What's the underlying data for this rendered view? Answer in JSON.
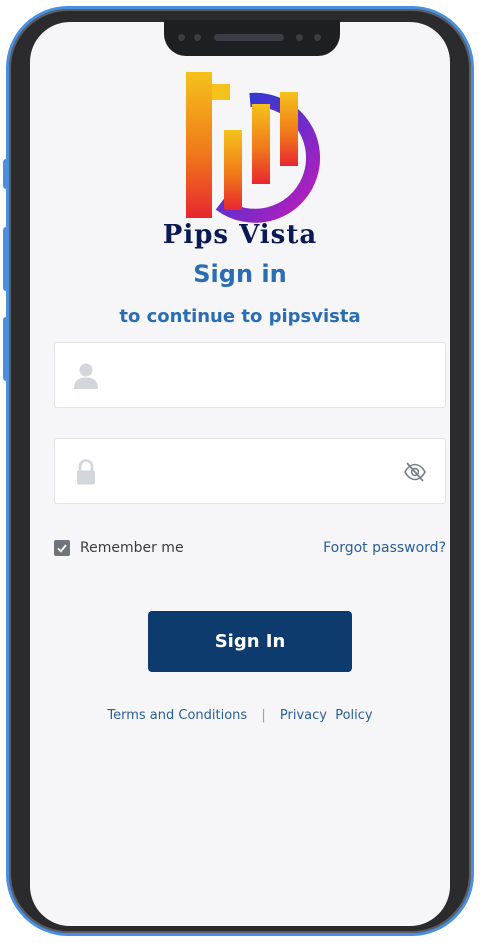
{
  "app": {
    "brand_name": "Pips Vista",
    "title": "Sign in",
    "subtitle": "to continue to pipsvista"
  },
  "form": {
    "username_value": "",
    "password_value": "",
    "remember_label": "Remember me",
    "remember_checked": true,
    "forgot_label": "Forgot password?",
    "submit_label": "Sign In"
  },
  "footer": {
    "terms_label": "Terms and Conditions",
    "separator": "|",
    "privacy_label": "Privacy  Policy"
  },
  "icons": {
    "username": "user-icon",
    "password": "lock-icon",
    "toggle_visibility": "eye-slash-icon",
    "checkbox": "check-icon"
  },
  "colors": {
    "primary_text": "#2a6db3",
    "button": "#0d3b6e",
    "brand_text": "#0b1a55",
    "frame_accent": "#4a8fe0"
  }
}
